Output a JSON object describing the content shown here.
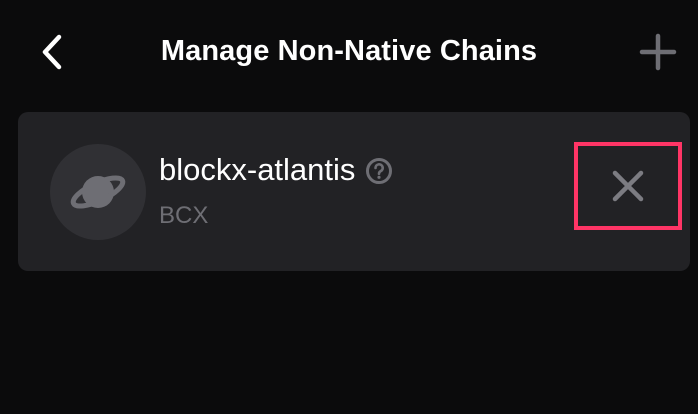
{
  "header": {
    "title": "Manage Non-Native Chains",
    "back_icon": "chevron-left-icon",
    "add_icon": "plus-icon"
  },
  "chains": [
    {
      "name": "blockx-atlantis",
      "symbol": "BCX",
      "avatar_icon": "planet-icon",
      "help_icon": "question-circle-icon",
      "remove_icon": "close-icon"
    }
  ],
  "colors": {
    "background": "#0b0b0c",
    "card": "#222225",
    "highlight": "#ff3566",
    "muted": "#6e6e74"
  }
}
